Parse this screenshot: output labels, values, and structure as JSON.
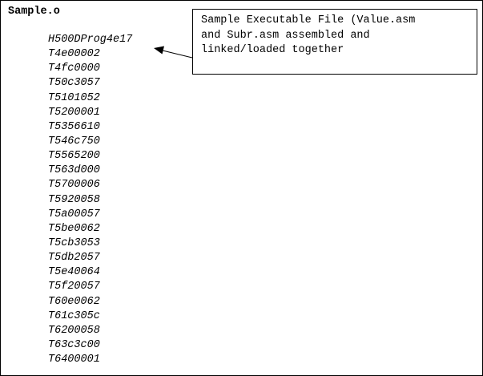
{
  "file_title": "Sample.o",
  "records": [
    "H500DProg4e17",
    "T4e00002",
    "T4fc0000",
    "T50c3057",
    "T5101052",
    "T5200001",
    "T5356610",
    "T546c750",
    "T5565200",
    "T563d000",
    "T5700006",
    "T5920058",
    "T5a00057",
    "T5be0062",
    "T5cb3053",
    "T5db2057",
    "T5e40064",
    "T5f20057",
    "T60e0062",
    "T61c305c",
    "T6200058",
    "T63c3c00",
    "T6400001"
  ],
  "callout": {
    "lines": [
      "Sample Executable File (Value.asm",
      "and Subr.asm assembled and",
      "linked/loaded together"
    ]
  },
  "colors": {
    "text": "#000000",
    "background": "#ffffff",
    "border": "#000000"
  }
}
